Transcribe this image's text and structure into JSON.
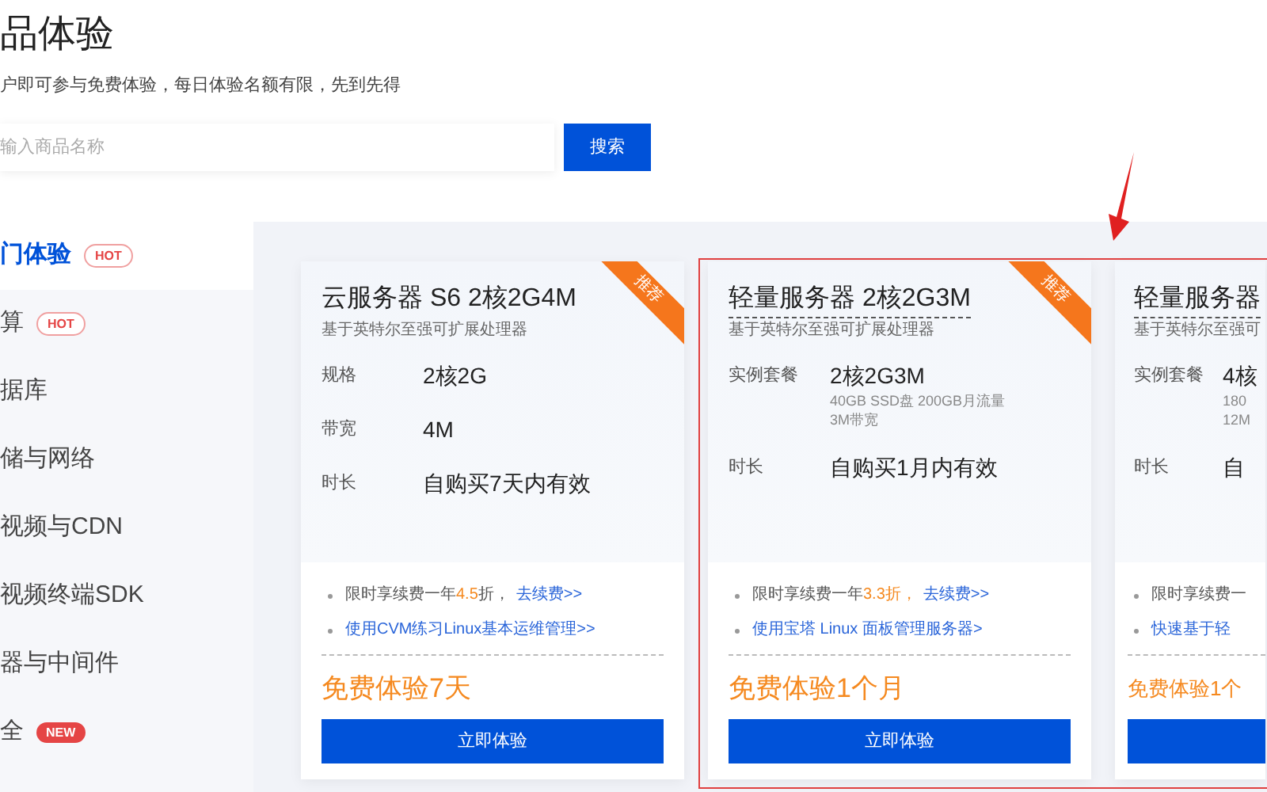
{
  "header": {
    "title": "品体验",
    "subtitle": "户即可参与免费体验，每日体验名额有限，先到先得"
  },
  "search": {
    "placeholder": "输入商品名称",
    "button": "搜索"
  },
  "sidebar": {
    "items": [
      {
        "label": "门体验",
        "badge": {
          "text": "HOT",
          "kind": "hot"
        },
        "selected": true
      },
      {
        "label": "算",
        "badge": {
          "text": "HOT",
          "kind": "hot"
        },
        "selected": false
      },
      {
        "label": "据库",
        "selected": false
      },
      {
        "label": "储与网络",
        "selected": false
      },
      {
        "label": "视频与CDN",
        "selected": false
      },
      {
        "label": "视频终端SDK",
        "selected": false
      },
      {
        "label": "器与中间件",
        "selected": false
      },
      {
        "label": "全",
        "badge": {
          "text": "NEW",
          "kind": "new"
        },
        "selected": false
      }
    ]
  },
  "cards": [
    {
      "title": "云服务器 S6 2核2G4M",
      "underlined": false,
      "subtitle": "基于英特尔至强可扩展处理器",
      "ribbon": "推荐",
      "specs": [
        {
          "label": "规格",
          "value": "2核2G"
        },
        {
          "label": "带宽",
          "value": "4M"
        },
        {
          "label": "时长",
          "value": "自购买7天内有效"
        }
      ],
      "promos": [
        {
          "prefix": "限时享续费一年",
          "highlight": "4.5",
          "suffix": " 折，",
          "link": "去续费>>"
        },
        {
          "link": "使用CVM练习Linux基本运维管理>>"
        }
      ],
      "trial": "免费体验7天",
      "button": "立即体验"
    },
    {
      "title": "轻量服务器 2核2G3M",
      "underlined": true,
      "subtitle": "基于英特尔至强可扩展处理器",
      "ribbon": "推荐",
      "specs": [
        {
          "label": "实例套餐",
          "value": "2核2G3M",
          "notes": [
            "40GB SSD盘 200GB月流量",
            "3M带宽"
          ]
        },
        {
          "label": "时长",
          "value": "自购买1月内有效"
        }
      ],
      "promos": [
        {
          "prefix": "限时享续费一年",
          "highlight": "3.3折，",
          "link": "去续费>>"
        },
        {
          "link": "使用宝塔 Linux 面板管理服务器>"
        }
      ],
      "trial": "免费体验1个月",
      "button": "立即体验"
    },
    {
      "title": "轻量服务器",
      "underlined": true,
      "subtitle": "基于英特尔至强可",
      "specs": [
        {
          "label": "实例套餐",
          "value": "4核",
          "notes": [
            "180",
            "12M"
          ]
        },
        {
          "label": "时长",
          "value": "自"
        }
      ],
      "promos": [
        {
          "prefix": "限时享续费一"
        },
        {
          "link": "快速基于轻"
        }
      ],
      "trial": "免费体验1个"
    }
  ]
}
